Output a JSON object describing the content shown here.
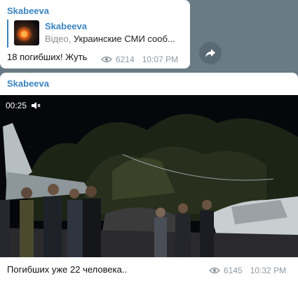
{
  "message1": {
    "sender": "Skabeeva",
    "reply": {
      "author": "Skabeeva",
      "source_label": "Відео,",
      "text": " Украинские СМИ сооб..."
    },
    "text": "18 погибших! Жуть",
    "views": "6214",
    "time": "10:07 PM"
  },
  "message2": {
    "sender": "Skabeeva",
    "video_duration": "00:25",
    "text": "Погибших уже 22 человека..",
    "views": "6145",
    "time": "10:32 PM"
  },
  "icons": {
    "views": "eye-icon",
    "share": "share-arrow-icon",
    "mute": "muted-speaker-icon"
  },
  "colors": {
    "accent": "#3a84c0",
    "background": "#6a7b85",
    "meta": "#8e9aa3"
  }
}
